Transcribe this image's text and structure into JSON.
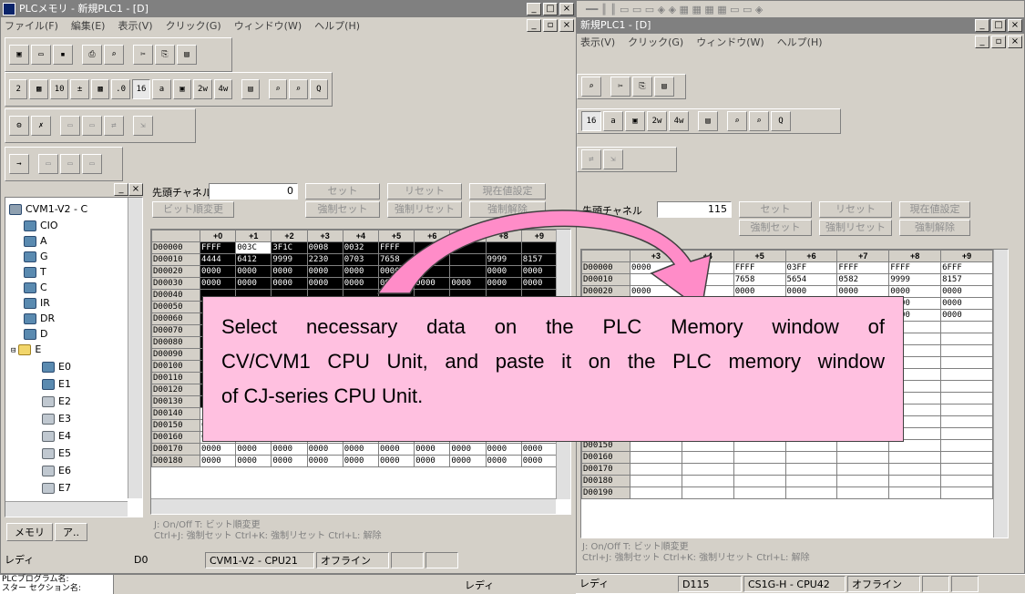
{
  "left_window": {
    "title": "PLCメモリ - 新規PLC1 - [D]",
    "menu": [
      "ファイル(F)",
      "編集(E)",
      "表示(V)",
      "クリック(G)",
      "ウィンドウ(W)",
      "ヘルプ(H)"
    ],
    "tree": {
      "root": "CVM1-V2 - C",
      "items": [
        "CIO",
        "A",
        "G",
        "T",
        "C",
        "IR",
        "DR",
        "D",
        "E",
        "E0",
        "E1",
        "E2",
        "E3",
        "E4",
        "E5",
        "E6",
        "E7"
      ]
    },
    "tabs": [
      "メモリ",
      "ア.."
    ],
    "top_channel_label": "先頭チャネル",
    "top_channel_value": "0",
    "buttons": {
      "set": "セット",
      "reset": "リセット",
      "present_value": "現在値設定",
      "bit_change": "ビット順変更",
      "force_set": "強制セット",
      "force_reset": "強制リセット",
      "force_release": "強制解除"
    },
    "grid": {
      "headers": [
        "",
        "+0",
        "+1",
        "+2",
        "+3",
        "+4",
        "+5",
        "+6",
        "+7",
        "+8",
        "+9"
      ],
      "rows": [
        [
          "D00000",
          "FFFF",
          "003C",
          "3F1C",
          "0008",
          "0032",
          "FFFF",
          "",
          "",
          "",
          ""
        ],
        [
          "D00010",
          "4444",
          "6412",
          "9999",
          "2230",
          "0703",
          "7658",
          "",
          "",
          "9999",
          "8157"
        ],
        [
          "D00020",
          "0000",
          "0000",
          "0000",
          "0000",
          "0000",
          "0000",
          "",
          "",
          "0000",
          "0000"
        ],
        [
          "D00030",
          "0000",
          "0000",
          "0000",
          "0000",
          "0000",
          "0000",
          "0000",
          "0000",
          "0000",
          "0000"
        ],
        [
          "D00040",
          "",
          "",
          "",
          "",
          "",
          "",
          "",
          "",
          "",
          ""
        ],
        [
          "D00050",
          "",
          "",
          "",
          "",
          "",
          "",
          "",
          "",
          "",
          ""
        ],
        [
          "D00060",
          "",
          "",
          "",
          "",
          "",
          "",
          "",
          "",
          "",
          ""
        ],
        [
          "D00070",
          "",
          "",
          "",
          "",
          "",
          "",
          "",
          "",
          "",
          ""
        ],
        [
          "D00080",
          "",
          "",
          "",
          "",
          "",
          "",
          "",
          "",
          "",
          ""
        ],
        [
          "D00090",
          "",
          "",
          "",
          "",
          "",
          "",
          "",
          "",
          "",
          ""
        ],
        [
          "D00100",
          "",
          "",
          "",
          "",
          "",
          "",
          "",
          "",
          "",
          ""
        ],
        [
          "D00110",
          "",
          "",
          "",
          "",
          "",
          "",
          "",
          "",
          "",
          ""
        ],
        [
          "D00120",
          "",
          "",
          "",
          "",
          "",
          "",
          "",
          "",
          "",
          ""
        ],
        [
          "D00130",
          "",
          "",
          "",
          "",
          "",
          "",
          "",
          "",
          "",
          ""
        ],
        [
          "D00140",
          "",
          "",
          "",
          "",
          "",
          "",
          "",
          "",
          "",
          ""
        ],
        [
          "D00150",
          "0000",
          "0000",
          "0000",
          "0000",
          "0000",
          "0000",
          "0000",
          "0000",
          "0000",
          "0000"
        ],
        [
          "D00160",
          "0000",
          "0000",
          "0000",
          "0000",
          "0000",
          "0000",
          "0000",
          "0000",
          "0000",
          "0000"
        ],
        [
          "D00170",
          "0000",
          "0000",
          "0000",
          "0000",
          "0000",
          "0000",
          "0000",
          "0000",
          "0000",
          "0000"
        ],
        [
          "D00180",
          "0000",
          "0000",
          "0000",
          "0000",
          "0000",
          "0000",
          "0000",
          "0000",
          "0000",
          "0000"
        ]
      ]
    },
    "hint_line1": "J: On/Off    T: ビット順変更",
    "hint_line2": "Ctrl+J: 強制セット    Ctrl+K: 強制リセット    Ctrl+L: 解除",
    "status": {
      "ready": "レディ",
      "area": "D0",
      "model": "CVM1-V2 - CPU21",
      "mode": "オフライン"
    }
  },
  "right_window": {
    "title": "新規PLC1 - [D]",
    "menu": [
      "表示(V)",
      "クリック(G)",
      "ウィンドウ(W)",
      "ヘルプ(H)"
    ],
    "top_channel_label": "先頭チャネル",
    "top_channel_value": "115",
    "buttons": {
      "set": "セット",
      "reset": "リセット",
      "present_value": "現在値設定",
      "force_set": "強制セット",
      "force_reset": "強制リセット",
      "force_release": "強制解除"
    },
    "grid": {
      "headers": [
        "",
        "+3",
        "+4",
        "+5",
        "+6",
        "+7",
        "+8",
        "+9"
      ],
      "rows": [
        [
          "D00000",
          "0000",
          "0032",
          "FFFF",
          "03FF",
          "FFFF",
          "FFFF",
          "6FFF"
        ],
        [
          "D00010",
          "",
          "0703",
          "7658",
          "5654",
          "0582",
          "9999",
          "8157"
        ],
        [
          "D00020",
          "0000",
          "0000",
          "0000",
          "0000",
          "0000",
          "0000",
          "0000"
        ],
        [
          "D00030",
          "",
          "",
          "",
          "",
          "0000",
          "0000",
          "0000"
        ],
        [
          "D00040",
          "",
          "",
          "",
          "",
          "0000",
          "0000",
          "0000"
        ],
        [
          "D00050",
          "",
          "",
          "",
          "",
          "",
          "",
          ""
        ],
        [
          "D00060",
          "",
          "",
          "",
          "",
          "",
          "",
          ""
        ],
        [
          "D00070",
          "",
          "",
          "",
          "",
          "",
          "",
          ""
        ],
        [
          "D00080",
          "",
          "",
          "",
          "",
          "",
          "",
          ""
        ],
        [
          "D00090",
          "",
          "",
          "",
          "",
          "",
          "",
          ""
        ],
        [
          "D00100",
          "",
          "",
          "",
          "",
          "",
          "",
          ""
        ],
        [
          "D00110",
          "",
          "",
          "",
          "",
          "",
          "",
          ""
        ],
        [
          "D00120",
          "",
          "",
          "",
          "",
          "",
          "",
          ""
        ],
        [
          "D00130",
          "",
          "",
          "",
          "",
          "",
          "",
          ""
        ],
        [
          "D00140",
          "",
          "",
          "",
          "",
          "",
          "",
          ""
        ],
        [
          "D00150",
          "",
          "",
          "",
          "",
          "",
          "",
          ""
        ],
        [
          "D00160",
          "",
          "",
          "",
          "",
          "",
          "",
          ""
        ],
        [
          "D00170",
          "",
          "",
          "",
          "",
          "",
          "",
          ""
        ],
        [
          "D00180",
          "",
          "",
          "",
          "",
          "",
          "",
          ""
        ],
        [
          "D00190",
          "",
          "",
          "",
          "",
          "",
          "",
          ""
        ]
      ]
    },
    "hint_line1": "J: On/Off    T: ビット順変更",
    "hint_line2": "Ctrl+J: 強制セット    Ctrl+K: 強制リセット    Ctrl+L: 解除",
    "status": {
      "ready": "レディ",
      "area": "D115",
      "model": "CS1G-H - CPU42",
      "mode": "オフライン"
    }
  },
  "bottom_strip": {
    "line1": "PLCプログラム名:",
    "line2": "スター セクション名:"
  },
  "callout": {
    "line1": "Select necessary data on the PLC Memory window of",
    "line2": "CV/CVM1 CPU Unit, and paste it on the PLC memory window",
    "line3": "of CJ-series CPU Unit.",
    "color": "#ffc0e0"
  },
  "arrow_color": "#ff8cc8"
}
